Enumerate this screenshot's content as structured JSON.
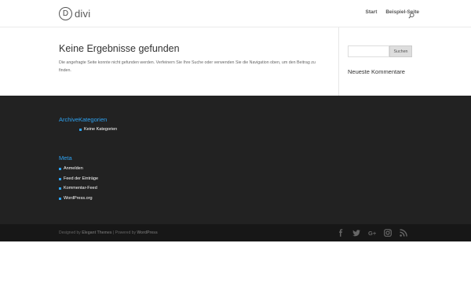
{
  "header": {
    "logo_letter": "D",
    "logo_text": "divi",
    "nav": [
      {
        "label": "Start"
      },
      {
        "label": "Beispiel-Seite"
      }
    ]
  },
  "main": {
    "title": "Keine Ergebnisse gefunden",
    "description": "Die angefragte Seite konnte nicht gefunden werden. Verfeinern Sie Ihre Suche oder verwenden Sie die Navigation oben, um den Beitrag zu finden."
  },
  "sidebar": {
    "search_value": "",
    "search_button": "Suchen",
    "recent_comments_title": "Neueste Kommentare"
  },
  "footer": {
    "widget1_title": "ArchiveKategorien",
    "categories": [
      "Keine Kategorien"
    ],
    "meta_title": "Meta",
    "meta_links": [
      "Anmelden",
      "Feed der Einträge",
      "Kommentar-Feed",
      "WordPress.org"
    ]
  },
  "bottom": {
    "designed_by": "Designed by ",
    "elegant_themes": "Elegant Themes",
    "separator": " | Powered by ",
    "wordpress": "WordPress",
    "social_icons": [
      "facebook-icon",
      "twitter-icon",
      "google-plus-icon",
      "instagram-icon",
      "rss-icon"
    ]
  },
  "colors": {
    "accent": "#2ea3f2",
    "footer_bg": "#222222",
    "bottom_bar_bg": "#171717"
  }
}
